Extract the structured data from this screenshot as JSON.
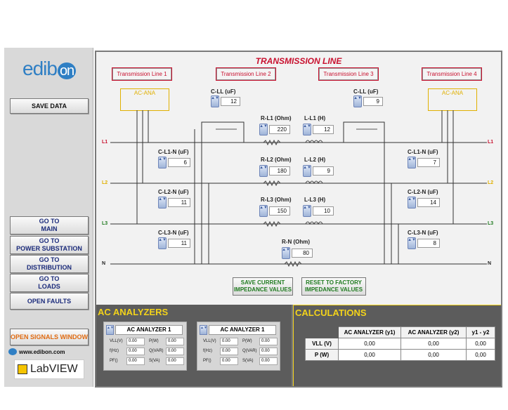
{
  "sidebar": {
    "logo_text": "edib",
    "logo_on": "on",
    "save_data": "SAVE DATA",
    "nav": [
      {
        "line1": "GO TO",
        "line2": "MAIN"
      },
      {
        "line1": "GO TO",
        "line2": "POWER SUBSTATION"
      },
      {
        "line1": "GO TO",
        "line2": "DISTRIBUTION"
      },
      {
        "line1": "GO TO",
        "line2": "LOADS"
      }
    ],
    "open_faults": "OPEN FAULTS",
    "open_signals": "OPEN SIGNALS WINDOW",
    "website": "www.edibon.com",
    "labview": "LabVIEW"
  },
  "main": {
    "title": "TRANSMISSION LINE",
    "tabs": [
      "Transmission Line 1",
      "Transmission Line 2",
      "Transmission Line 3",
      "Transmission Line 4"
    ],
    "ana_left": "AC-ANA",
    "ana_right": "AC-ANA",
    "line_labels": {
      "l1": "L1",
      "l2": "L2",
      "l3": "L3",
      "n": "N"
    },
    "controls": {
      "cll_left": {
        "label": "C-LL (uF)",
        "value": "12"
      },
      "cll_right": {
        "label": "C-LL (uF)",
        "value": "9"
      },
      "rl1": {
        "label": "R-L1 (Ohm)",
        "value": "220"
      },
      "ll1": {
        "label": "L-L1 (H)",
        "value": "12"
      },
      "rl2": {
        "label": "R-L2 (Ohm)",
        "value": "180"
      },
      "ll2": {
        "label": "L-L2 (H)",
        "value": "9"
      },
      "rl3": {
        "label": "R-L3 (Ohm)",
        "value": "150"
      },
      "ll3": {
        "label": "L-L3 (H)",
        "value": "10"
      },
      "rn": {
        "label": "R-N (Ohm)",
        "value": "80"
      },
      "cl1n_left": {
        "label": "C-L1-N (uF)",
        "value": "6"
      },
      "cl2n_left": {
        "label": "C-L2-N (uF)",
        "value": "11"
      },
      "cl3n_left": {
        "label": "C-L3-N (uF)",
        "value": "11"
      },
      "cl1n_right": {
        "label": "C-L1-N (uF)",
        "value": "7"
      },
      "cl2n_right": {
        "label": "C-L2-N (uF)",
        "value": "14"
      },
      "cl3n_right": {
        "label": "C-L3-N (uF)",
        "value": "8"
      }
    },
    "save_current": {
      "line1": "SAVE CURRENT",
      "line2": "IMPEDANCE VALUES"
    },
    "reset_factory": {
      "line1": "RESET TO FACTORY",
      "line2": "IMPEDANCE VALUES"
    }
  },
  "analyzers": {
    "title": "AC ANALYZERS",
    "units": [
      {
        "name": "AC ANALYZER 1",
        "vll_label": "VLL(V)",
        "vll": "0.00",
        "p_label": "P(W)",
        "p": "0.00",
        "f_label": "f(Hz)",
        "f": "0.00",
        "q_label": "Q(VAR)",
        "q": "0.00",
        "pf_label": "PF()",
        "pf": "0.00",
        "s_label": "S(VA)",
        "s": "0.00"
      },
      {
        "name": "AC ANALYZER 1",
        "vll_label": "VLL(V)",
        "vll": "0.00",
        "p_label": "P(W)",
        "p": "0.00",
        "f_label": "f(Hz)",
        "f": "0.00",
        "q_label": "Q(VAR)",
        "q": "0.00",
        "pf_label": "PF()",
        "pf": "0.00",
        "s_label": "S(VA)",
        "s": "0.00"
      }
    ]
  },
  "calculations": {
    "title": "CALCULATIONS",
    "headers": [
      "AC ANALYZER (y1)",
      "AC ANALYZER (y2)",
      "y1 - y2"
    ],
    "rows": [
      {
        "label": "VLL (V)",
        "values": [
          "0,00",
          "0,00",
          "0,00"
        ]
      },
      {
        "label": "P (W)",
        "values": [
          "0,00",
          "0,00",
          "0,00"
        ]
      }
    ]
  },
  "colors": {
    "title_red": "#c8102e",
    "accent_yellow": "#f3d31a",
    "nav_blue": "#1a2a7a",
    "button_green": "#1f7a1f",
    "orange": "#e06a10"
  }
}
